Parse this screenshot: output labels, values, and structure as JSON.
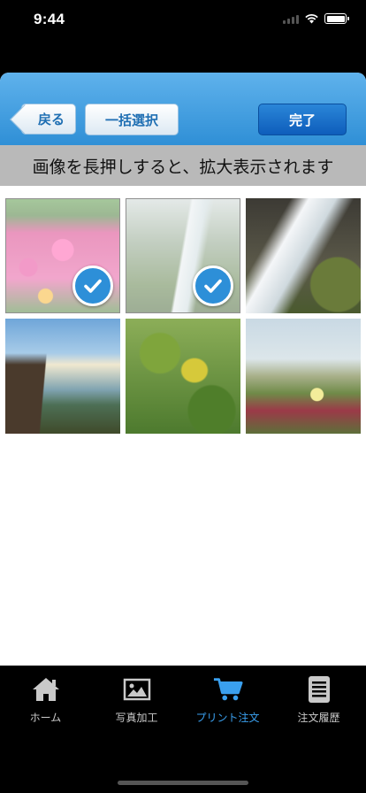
{
  "status_bar": {
    "time": "9:44"
  },
  "nav": {
    "back_label": "戻る",
    "select_all_label": "一括選択",
    "done_label": "完了"
  },
  "hint": "画像を長押しすると、拡大表示されます",
  "photos": [
    {
      "subject": "pink flowers",
      "selected": true
    },
    {
      "subject": "waterfall in misty green valley",
      "selected": true
    },
    {
      "subject": "cascading water over mossy rocks",
      "selected": false
    },
    {
      "subject": "waterfall beside rocky cliff",
      "selected": false
    },
    {
      "subject": "green and yellow leaves",
      "selected": false
    },
    {
      "subject": "coastal wildflowers",
      "selected": false
    }
  ],
  "tabs": [
    {
      "label": "ホーム",
      "icon": "home-icon",
      "active": false
    },
    {
      "label": "写真加工",
      "icon": "image-icon",
      "active": false
    },
    {
      "label": "プリント注文",
      "icon": "cart-icon",
      "active": true
    },
    {
      "label": "注文履歴",
      "icon": "document-icon",
      "active": false
    }
  ],
  "colors": {
    "nav_gradient_top": "#5fb2ec",
    "nav_gradient_bottom": "#2f8fd6",
    "done_button": "#0e5dbb",
    "active_tab": "#3aa0ef",
    "check_badge": "#2d8fd8",
    "hint_background": "#b9b9b9"
  }
}
